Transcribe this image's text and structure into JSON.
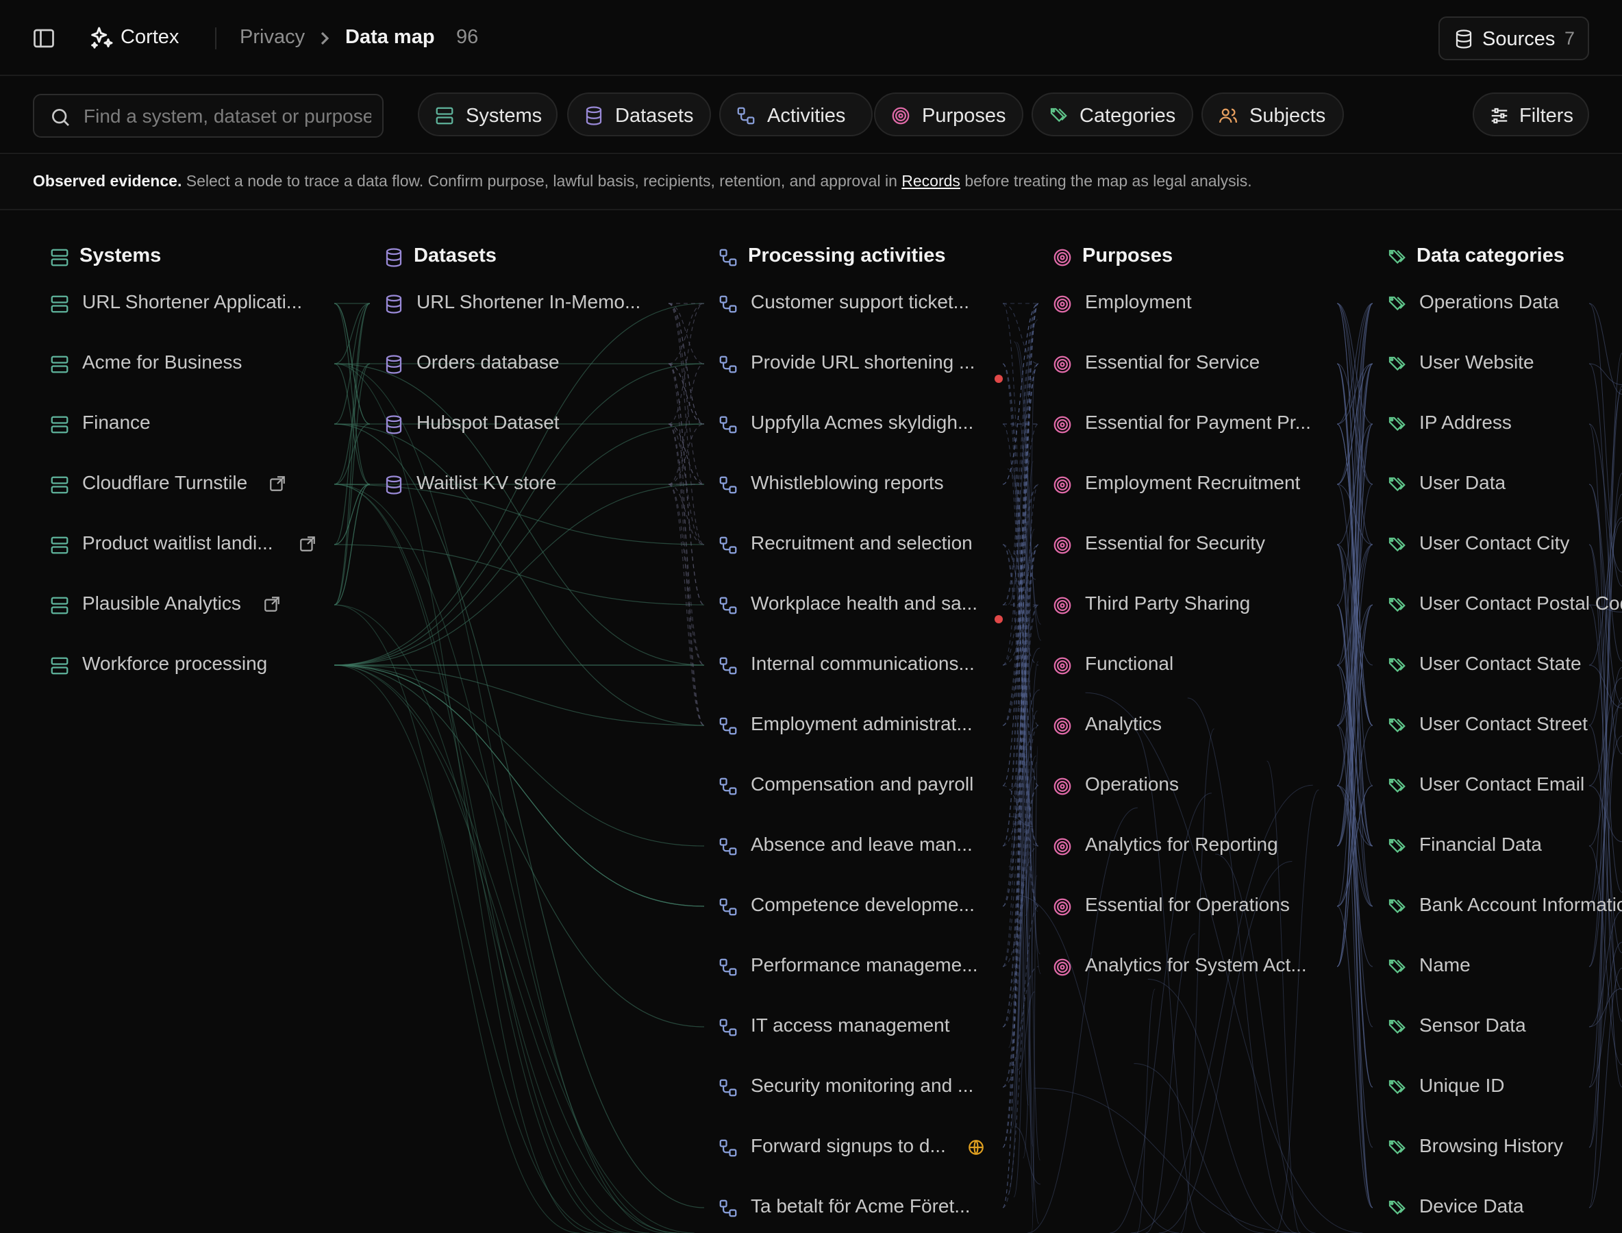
{
  "topbar": {
    "app_name": "Cortex",
    "breadcrumb_parent": "Privacy",
    "breadcrumb_current": "Data map",
    "node_count": "96",
    "sources_label": "Sources",
    "sources_count": "7"
  },
  "filterbar": {
    "search_placeholder": "Find a system, dataset or purpose",
    "chips": [
      "Systems",
      "Datasets",
      "Activities",
      "Purposes",
      "Categories",
      "Subjects"
    ],
    "filters_label": "Filters"
  },
  "notice": {
    "lead": "Observed evidence.",
    "text_before": " Select a node to trace a data flow. Confirm purpose, lawful basis, recipients, retention, and approval in ",
    "link": "Records",
    "text_after": " before treating the map as legal analysis."
  },
  "columns": {
    "systems": {
      "title": "Systems",
      "items": [
        "URL Shortener Applicati...",
        "Acme for Business",
        "Finance",
        "Cloudflare Turnstile",
        "Product waitlist landi...",
        "Plausible Analytics",
        "Workforce processing"
      ]
    },
    "datasets": {
      "title": "Datasets",
      "items": [
        "URL Shortener In-Memo...",
        "Orders database",
        "Hubspot Dataset",
        "Waitlist KV store"
      ]
    },
    "activities": {
      "title": "Processing activities",
      "items": [
        "Customer support ticket...",
        "Provide URL shortening ...",
        "Uppfylla Acmes skyldigh...",
        "Whistleblowing reports",
        "Recruitment and selection",
        "Workplace health and sa...",
        "Internal communications...",
        "Employment administrat...",
        "Compensation and payroll",
        "Absence and leave man...",
        "Competence developme...",
        "Performance manageme...",
        "IT access management",
        "Security monitoring and ...",
        "Forward signups to d...",
        "Ta betalt för Acme Föret..."
      ]
    },
    "purposes": {
      "title": "Purposes",
      "items": [
        "Employment",
        "Essential for Service",
        "Essential for Payment Pr...",
        "Employment Recruitment",
        "Essential for Security",
        "Third Party Sharing",
        "Functional",
        "Analytics",
        "Operations",
        "Analytics for Reporting",
        "Essential for Operations",
        "Analytics for System Act..."
      ]
    },
    "categories": {
      "title": "Data categories",
      "items": [
        "Operations Data",
        "User Website",
        "IP Address",
        "User Data",
        "User Contact City",
        "User Contact Postal Code",
        "User Contact State",
        "User Contact Street",
        "User Contact Email",
        "Financial Data",
        "Bank Account Information",
        "Name",
        "Sensor Data",
        "Unique ID",
        "Browsing History",
        "Device Data"
      ]
    }
  },
  "colors": {
    "systems_icon": "#5fb49c",
    "datasets_icon": "#9a8ad8",
    "activities_icon": "#8aa0dc",
    "purposes_icon": "#e06aa8",
    "categories_icon": "#5fc48a",
    "system_edges": "#3f7a64",
    "dataset_edges": "#5a5a72",
    "purpose_edges": "#5a6a9a",
    "alert_dot": "#e04848",
    "globe_badge": "#e0a020"
  }
}
